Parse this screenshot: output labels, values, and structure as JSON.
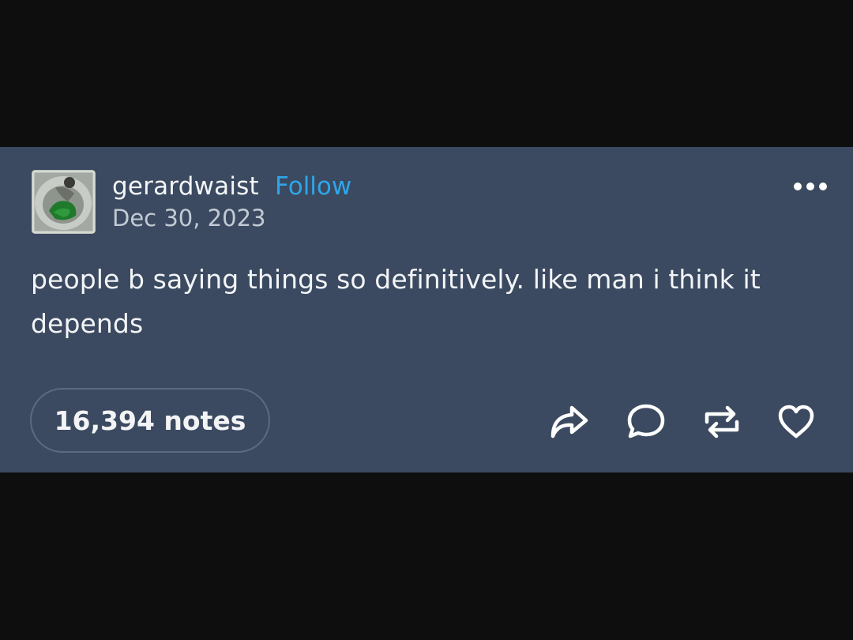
{
  "post": {
    "username": "gerardwaist",
    "follow_label": "Follow",
    "date": "Dec 30, 2023",
    "body": "people b saying things so definitively. like man i think it depends",
    "notes": "16,394 notes"
  },
  "icons": {
    "more": "more-horizontal-icon",
    "share": "share-arrow-icon",
    "reply": "comment-bubble-icon",
    "reblog": "reblog-icon",
    "like": "heart-icon"
  },
  "colors": {
    "card_background": "#3b4a60",
    "page_background": "#0e0e0f",
    "follow_accent": "#2fa6ea",
    "text": "#f2f4f7",
    "muted_text": "#c3cad5"
  }
}
